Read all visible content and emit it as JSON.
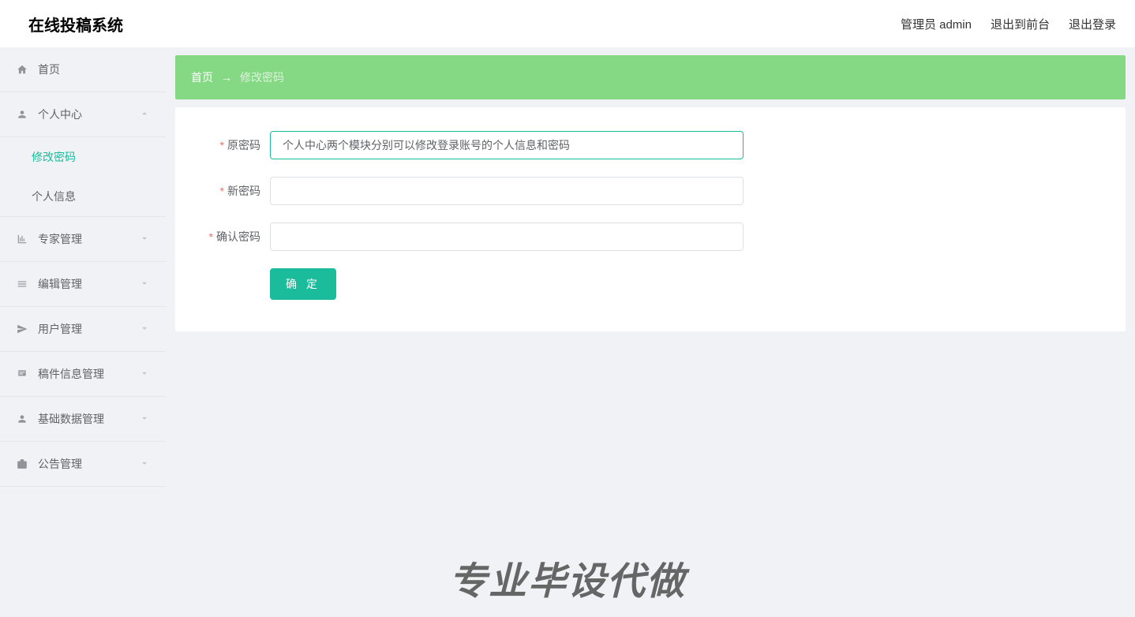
{
  "header": {
    "logo": "在线投稿系统",
    "admin_label": "管理员 admin",
    "exit_front": "退出到前台",
    "logout": "退出登录"
  },
  "sidebar": {
    "home": "首页",
    "personal": "个人中心",
    "change_pwd": "修改密码",
    "personal_info": "个人信息",
    "expert_mgmt": "专家管理",
    "edit_mgmt": "编辑管理",
    "user_mgmt": "用户管理",
    "manuscript_mgmt": "稿件信息管理",
    "basedata_mgmt": "基础数据管理",
    "notice_mgmt": "公告管理"
  },
  "breadcrumb": {
    "home": "首页",
    "arrow": "→",
    "current": "修改密码"
  },
  "form": {
    "old_pwd_label": "原密码",
    "old_pwd_value": "个人中心两个模块分别可以修改登录账号的个人信息和密码",
    "new_pwd_label": "新密码",
    "confirm_pwd_label": "确认密码",
    "submit": "确 定"
  },
  "watermark": "专业毕设代做"
}
